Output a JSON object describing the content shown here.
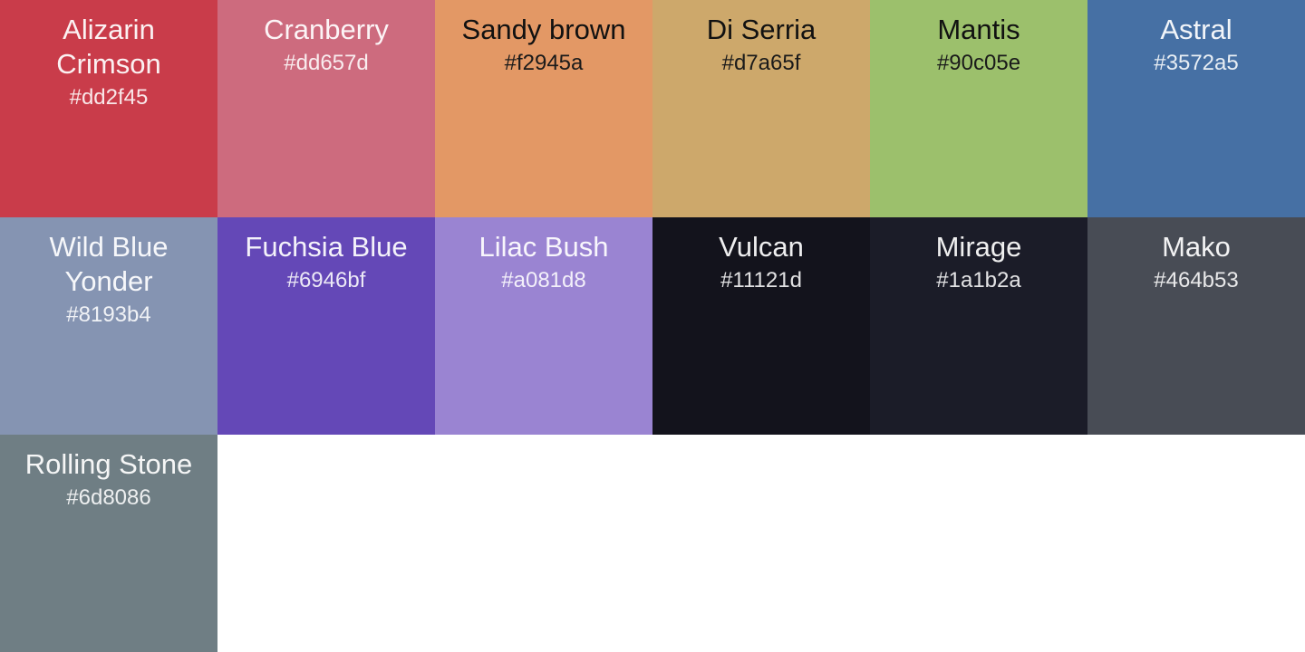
{
  "swatches": [
    {
      "name": "Alizarin Crimson",
      "hex": "#dd2f45",
      "color": "#c93c4a",
      "text": "light"
    },
    {
      "name": "Cranberry",
      "hex": "#dd657d",
      "color": "#cd6b7e",
      "text": "light"
    },
    {
      "name": "Sandy brown",
      "hex": "#f2945a",
      "color": "#e39865",
      "text": "dark"
    },
    {
      "name": "Di Serria",
      "hex": "#d7a65f",
      "color": "#cda86b",
      "text": "dark"
    },
    {
      "name": "Mantis",
      "hex": "#90c05e",
      "color": "#9cc06c",
      "text": "dark"
    },
    {
      "name": "Astral",
      "hex": "#3572a5",
      "color": "#4670a4",
      "text": "light"
    },
    {
      "name": "Wild Blue Yonder",
      "hex": "#8193b4",
      "color": "#8594b2",
      "text": "light"
    },
    {
      "name": "Fuchsia Blue",
      "hex": "#6946bf",
      "color": "#6448b7",
      "text": "light"
    },
    {
      "name": "Lilac Bush",
      "hex": "#a081d8",
      "color": "#9a84d2",
      "text": "light"
    },
    {
      "name": "Vulcan",
      "hex": "#11121d",
      "color": "#13131c",
      "text": "light"
    },
    {
      "name": "Mirage",
      "hex": "#1a1b2a",
      "color": "#1b1c28",
      "text": "light"
    },
    {
      "name": "Mako",
      "hex": "#464b53",
      "color": "#484c55",
      "text": "light"
    },
    {
      "name": "Rolling Stone",
      "hex": "#6d8086",
      "color": "#6f7e84",
      "text": "light"
    }
  ]
}
